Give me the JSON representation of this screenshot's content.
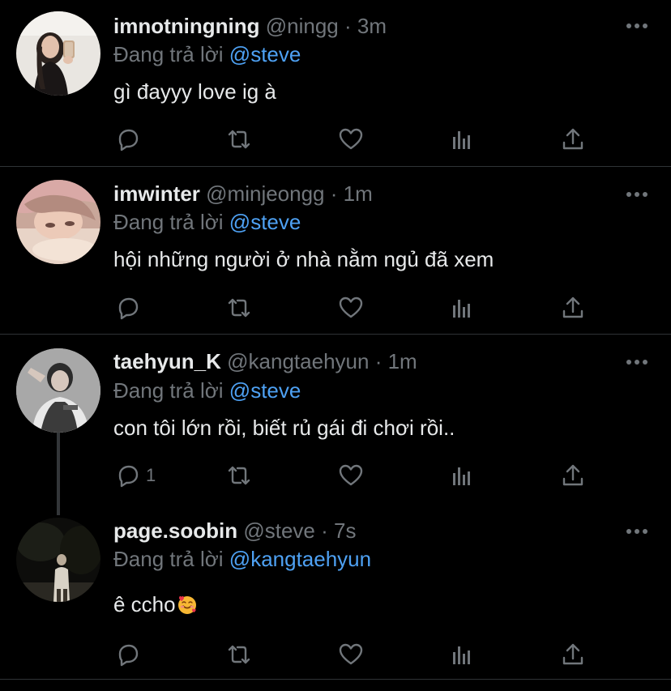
{
  "reply_prefix": "Đang trả lời",
  "colors": {
    "background": "#000000",
    "divider": "#2f3336",
    "muted": "#71767b",
    "mention": "#4ea1f3",
    "text": "#e7e9ea"
  },
  "icons": [
    "reply-icon",
    "retweet-icon",
    "like-icon",
    "analytics-icon",
    "share-icon",
    "more-options-icon"
  ],
  "tweets": [
    {
      "name": "imnotningning",
      "handle": "@ningg",
      "separator": "·",
      "time": "3m",
      "reply_to": "@steve",
      "text": "gì đayyy love ig à",
      "reply_count": ""
    },
    {
      "name": "imwinter",
      "handle": "@minjeongg",
      "separator": "·",
      "time": "1m",
      "reply_to": "@steve",
      "text": "hội những người ở nhà nằm ngủ đã xem",
      "reply_count": ""
    },
    {
      "name": "taehyun_K",
      "handle": "@kangtaehyun",
      "separator": "·",
      "time": "1m",
      "reply_to": "@steve",
      "text": "con tôi lớn rồi, biết rủ gái đi chơi rồi..",
      "reply_count": "1"
    },
    {
      "name": "page.soobin",
      "handle": "@steve",
      "separator": "·",
      "time": "7s",
      "reply_to": "@kangtaehyun",
      "text": "ê ccho",
      "emoji": "smiling-face-with-hearts",
      "reply_count": ""
    }
  ]
}
